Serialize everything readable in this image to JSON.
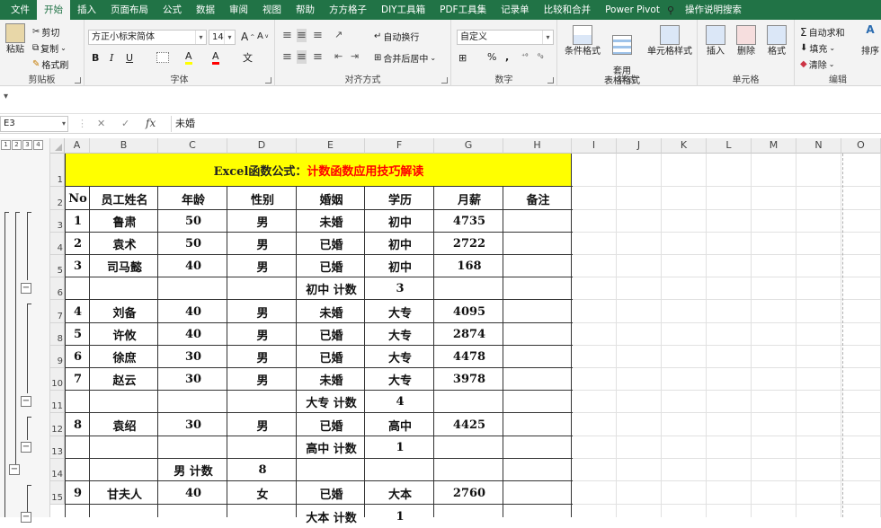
{
  "ribbon": {
    "tabs": [
      "文件",
      "开始",
      "插入",
      "页面布局",
      "公式",
      "数据",
      "审阅",
      "视图",
      "帮助",
      "方方格子",
      "DIY工具箱",
      "PDF工具集",
      "记录单",
      "比较和合并",
      "Power Pivot",
      "操作说明搜索"
    ],
    "active_tab": "开始",
    "clipboard": {
      "paste": "粘贴",
      "cut": "剪切",
      "copy": "复制",
      "format_painter": "格式刷",
      "label": "剪贴板"
    },
    "font": {
      "name": "方正小标宋简体",
      "size": "14",
      "grow": "A",
      "shrink": "A",
      "bold": "B",
      "italic": "I",
      "underline": "U",
      "label": "字体",
      "fill_glyph": "A",
      "color_glyph": "A",
      "wen": "文"
    },
    "align": {
      "wrap": "自动换行",
      "merge": "合并后居中",
      "label": "对齐方式"
    },
    "number": {
      "format": "自定义",
      "percent": "%",
      "comma": ",",
      "label": "数字"
    },
    "styles": {
      "cond": "条件格式",
      "table": "套用\n表格格式",
      "cell_style": "单元格样式",
      "label": "样式"
    },
    "cells": {
      "insert": "插入",
      "delete": "删除",
      "format": "格式",
      "label": "单元格"
    },
    "editing": {
      "autosum": "自动求和",
      "fill": "填充",
      "clear": "清除",
      "sort": "排序",
      "label": "编辑"
    }
  },
  "formula_bar": {
    "name_box": "E3",
    "cancel": "✕",
    "enter": "✓",
    "fx": "fx",
    "value": "未婚"
  },
  "outline_levels": [
    "1",
    "2",
    "3",
    "4"
  ],
  "columns": [
    "A",
    "B",
    "C",
    "D",
    "E",
    "F",
    "G",
    "H",
    "I",
    "J",
    "K",
    "L",
    "M",
    "N",
    "O"
  ],
  "rows": [
    "1",
    "2",
    "3",
    "4",
    "5",
    "6",
    "7",
    "8",
    "9",
    "10",
    "11",
    "12",
    "13",
    "14",
    "15"
  ],
  "title": {
    "black": "Excel函数公式：",
    "red": "计数函数应用技巧解读"
  },
  "headers": [
    "No",
    "员工姓名",
    "年龄",
    "性别",
    "婚姻",
    "学历",
    "月薪",
    "备注"
  ],
  "table": [
    [
      "1",
      "鲁肃",
      "50",
      "男",
      "未婚",
      "初中",
      "4735",
      ""
    ],
    [
      "2",
      "袁术",
      "50",
      "男",
      "已婚",
      "初中",
      "2722",
      ""
    ],
    [
      "3",
      "司马懿",
      "40",
      "男",
      "已婚",
      "初中",
      "168",
      ""
    ],
    [
      "",
      "",
      "",
      "",
      "初中 计数",
      "3",
      "",
      ""
    ],
    [
      "4",
      "刘备",
      "40",
      "男",
      "未婚",
      "大专",
      "4095",
      ""
    ],
    [
      "5",
      "许攸",
      "40",
      "男",
      "已婚",
      "大专",
      "2874",
      ""
    ],
    [
      "6",
      "徐庶",
      "30",
      "男",
      "已婚",
      "大专",
      "4478",
      ""
    ],
    [
      "7",
      "赵云",
      "30",
      "男",
      "未婚",
      "大专",
      "3978",
      ""
    ],
    [
      "",
      "",
      "",
      "",
      "大专 计数",
      "4",
      "",
      ""
    ],
    [
      "8",
      "袁绍",
      "30",
      "男",
      "已婚",
      "高中",
      "4425",
      ""
    ],
    [
      "",
      "",
      "",
      "",
      "高中 计数",
      "1",
      "",
      ""
    ],
    [
      "",
      "",
      "男 计数",
      "8",
      "",
      "",
      "",
      ""
    ],
    [
      "9",
      "甘夫人",
      "40",
      "女",
      "已婚",
      "大本",
      "2760",
      ""
    ],
    [
      "",
      "",
      "",
      "",
      "大本 计数",
      "1",
      "",
      ""
    ]
  ]
}
